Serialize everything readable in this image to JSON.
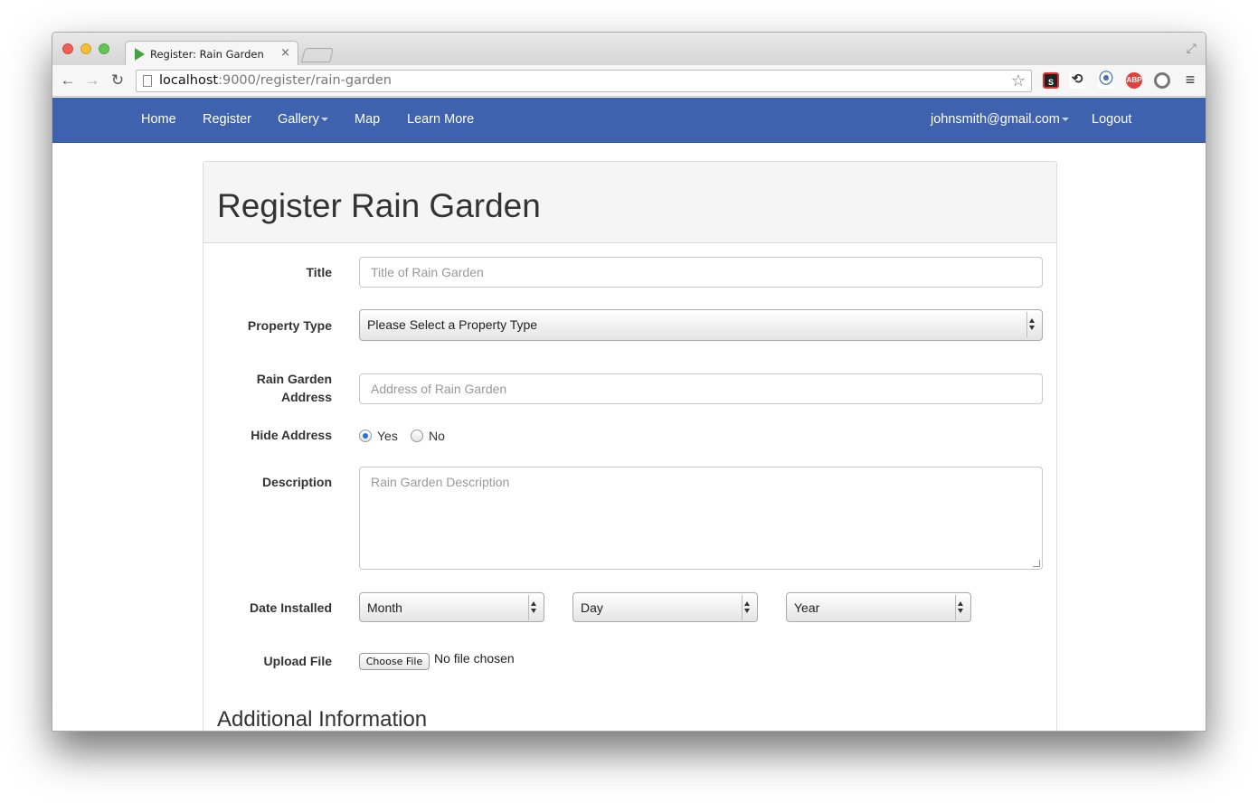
{
  "browser": {
    "tab_title": "Register: Rain Garden",
    "tab_close": "×",
    "url_host": "localhost",
    "url_rest": ":9000/register/rain-garden",
    "extensions": [
      "S",
      "⟲",
      "⦿",
      "ABP",
      "",
      "≡"
    ]
  },
  "nav": {
    "links": [
      "Home",
      "Register",
      "Gallery",
      "Map",
      "Learn More"
    ],
    "user": "johnsmith@gmail.com",
    "logout": "Logout",
    "color": "#3e62ad"
  },
  "form": {
    "heading": "Register Rain Garden",
    "title_label": "Title",
    "title_placeholder": "Title of Rain Garden",
    "property_label": "Property Type",
    "property_value": "Please Select a Property Type",
    "address_label_line1": "Rain Garden",
    "address_label_line2": "Address",
    "address_placeholder": "Address of Rain Garden",
    "hide_label": "Hide Address",
    "hide_yes": "Yes",
    "hide_no": "No",
    "hide_selected": "Yes",
    "description_label": "Description",
    "description_placeholder": "Rain Garden Description",
    "date_label": "Date Installed",
    "month": "Month",
    "day": "Day",
    "year": "Year",
    "upload_label": "Upload File",
    "choose_file": "Choose File",
    "file_status": "No file chosen",
    "additional": "Additional Information"
  }
}
